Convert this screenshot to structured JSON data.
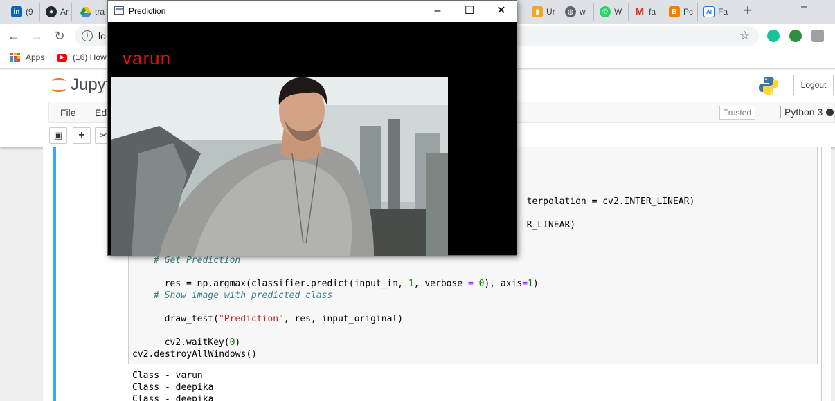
{
  "browser": {
    "tabs": [
      {
        "label": "(9",
        "icon": "linkedin-icon",
        "color": "#0a66c2"
      },
      {
        "label": "Ar",
        "icon": "github-icon",
        "color": "#24292e"
      },
      {
        "label": "tra",
        "icon": "drive-icon",
        "color": "#fbbc04"
      },
      {
        "label": "Ur",
        "icon": "book-icon",
        "color": "#f5a623"
      },
      {
        "label": "w",
        "icon": "globe-icon",
        "color": "#5f6368"
      },
      {
        "label": "W",
        "icon": "whatsapp-icon",
        "color": "#25d366"
      },
      {
        "label": "fa",
        "icon": "gmail-icon",
        "color": "#d93025"
      },
      {
        "label": "Pc",
        "icon": "blogger-icon",
        "color": "#f57d00"
      },
      {
        "label": "Fa",
        "icon": "ai-icon",
        "color": "#1a73e8"
      }
    ],
    "new_tab": "+",
    "minimize": "–",
    "url": "lo",
    "bookmarks": [
      {
        "label": "Apps",
        "icon": "apps-grid-icon"
      },
      {
        "label": "(16) How",
        "icon": "youtube-icon"
      }
    ]
  },
  "jupyter": {
    "logo_text": "Jupyt",
    "logout_label": "Logout",
    "menu": [
      "File",
      "Edi"
    ],
    "trusted_label": "Trusted",
    "kernel_label": "Python 3",
    "toolbar_buttons": [
      "save-icon",
      "plus-icon",
      "cut-icon"
    ]
  },
  "code": {
    "partial_line_1": "terpolation = cv2.INTER_LINEAR)",
    "partial_line_2": "R_LINEAR)",
    "comment_prediction": "# Get Prediction",
    "line_res": [
      "res = np.argmax(classifier.predict(input_im, ",
      "1",
      ", verbose ",
      "=",
      " ",
      "0",
      "), axis",
      "=",
      "1",
      ")"
    ],
    "comment_show": "# Show image with predicted class",
    "line_draw": [
      "draw_test(",
      "\"Prediction\"",
      ", res, input_original)"
    ],
    "line_wait": [
      "cv2.waitKey(",
      "0",
      ")"
    ],
    "line_destroy": "cv2.destroyAllWindows()"
  },
  "output": {
    "lines": [
      "Class - varun",
      "Class - deepika",
      "Class - deepika"
    ]
  },
  "prediction_window": {
    "title": "Prediction",
    "predicted_label": "varun",
    "label_color": "#e01010",
    "controls": {
      "minimize": "–",
      "maximize": "☐",
      "close": "✕"
    }
  }
}
